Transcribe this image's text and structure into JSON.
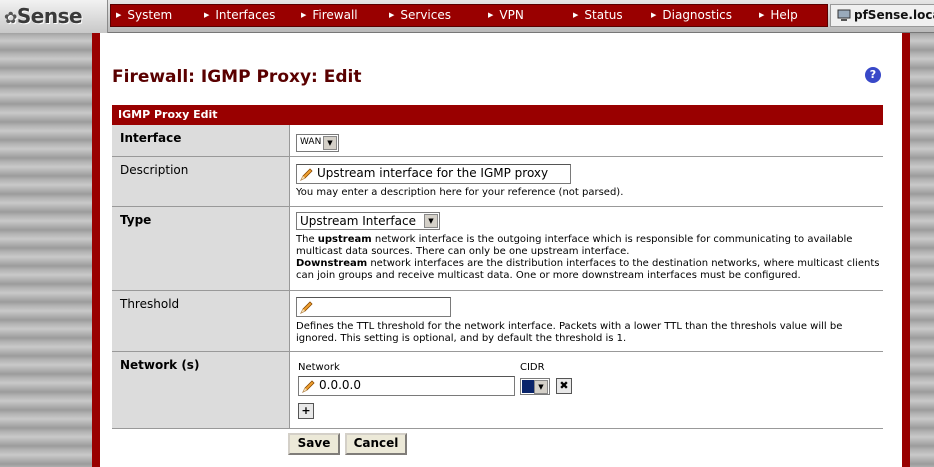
{
  "logo": {
    "text": "Sense"
  },
  "menu": [
    {
      "label": "System"
    },
    {
      "label": "Interfaces"
    },
    {
      "label": "Firewall"
    },
    {
      "label": "Services"
    },
    {
      "label": "VPN"
    },
    {
      "label": "Status"
    },
    {
      "label": "Diagnostics"
    },
    {
      "label": "Help"
    }
  ],
  "host": {
    "name": "pfSense.localdomain"
  },
  "page": {
    "title": "Firewall: IGMP Proxy: Edit",
    "help_icon": "?"
  },
  "section": {
    "header": "IGMP Proxy Edit"
  },
  "form": {
    "interface": {
      "label": "Interface",
      "value": "WAN"
    },
    "description": {
      "label": "Description",
      "value": "Upstream interface for the IGMP proxy",
      "help": "You may enter a description here for your reference (not parsed)."
    },
    "type": {
      "label": "Type",
      "value": "Upstream Interface",
      "help_upstream_bold": "upstream",
      "help_upstream_pre": "The ",
      "help_upstream_post": " network interface is the outgoing interface which is responsible for communicating to available multicast data sources. There can only be one upstream interface.",
      "help_downstream_bold": "Downstream",
      "help_downstream_post": " network interfaces are the distribution interfaces to the destination networks, where multicast clients can join groups and receive multicast data. One or more downstream interfaces must be configured."
    },
    "threshold": {
      "label": "Threshold",
      "value": "",
      "help": "Defines the TTL threshold for the network interface. Packets with a lower TTL than the threshols value will be ignored. This setting is optional, and by default the threshold is 1."
    },
    "network": {
      "label": "Network (s)",
      "col_network": "Network",
      "col_cidr": "CIDR",
      "value": "0.0.0.0",
      "cidr_value": ""
    }
  },
  "buttons": {
    "save": "Save",
    "cancel": "Cancel"
  },
  "colors": {
    "accent": "#990000",
    "label_bg": "#dcdcdc"
  },
  "icons": [
    "pencil-icon",
    "delete-icon",
    "add-icon",
    "help-icon",
    "host-icon"
  ]
}
